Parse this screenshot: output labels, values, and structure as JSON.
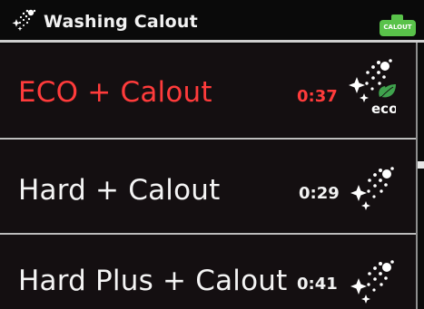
{
  "header": {
    "title": "Washing Calout",
    "icon": "dishwasher-spray-icon",
    "badge": {
      "label": "CALOUT",
      "icon": "calout-bottle-icon",
      "color": "#59c24a"
    }
  },
  "programs": [
    {
      "label": "ECO + Calout",
      "time": "0:37",
      "icon": "eco-spray-icon",
      "eco_badge": "eco",
      "selected": true
    },
    {
      "label": "Hard + Calout",
      "time": "0:29",
      "icon": "spray-icon",
      "selected": false
    },
    {
      "label": "Hard Plus + Calout",
      "time": "0:41",
      "icon": "spray-icon",
      "selected": false
    }
  ],
  "colors": {
    "selected_text": "#ff3b3b",
    "normal_text": "#f4f4f4",
    "eco_leaf": "#3fa34d"
  }
}
